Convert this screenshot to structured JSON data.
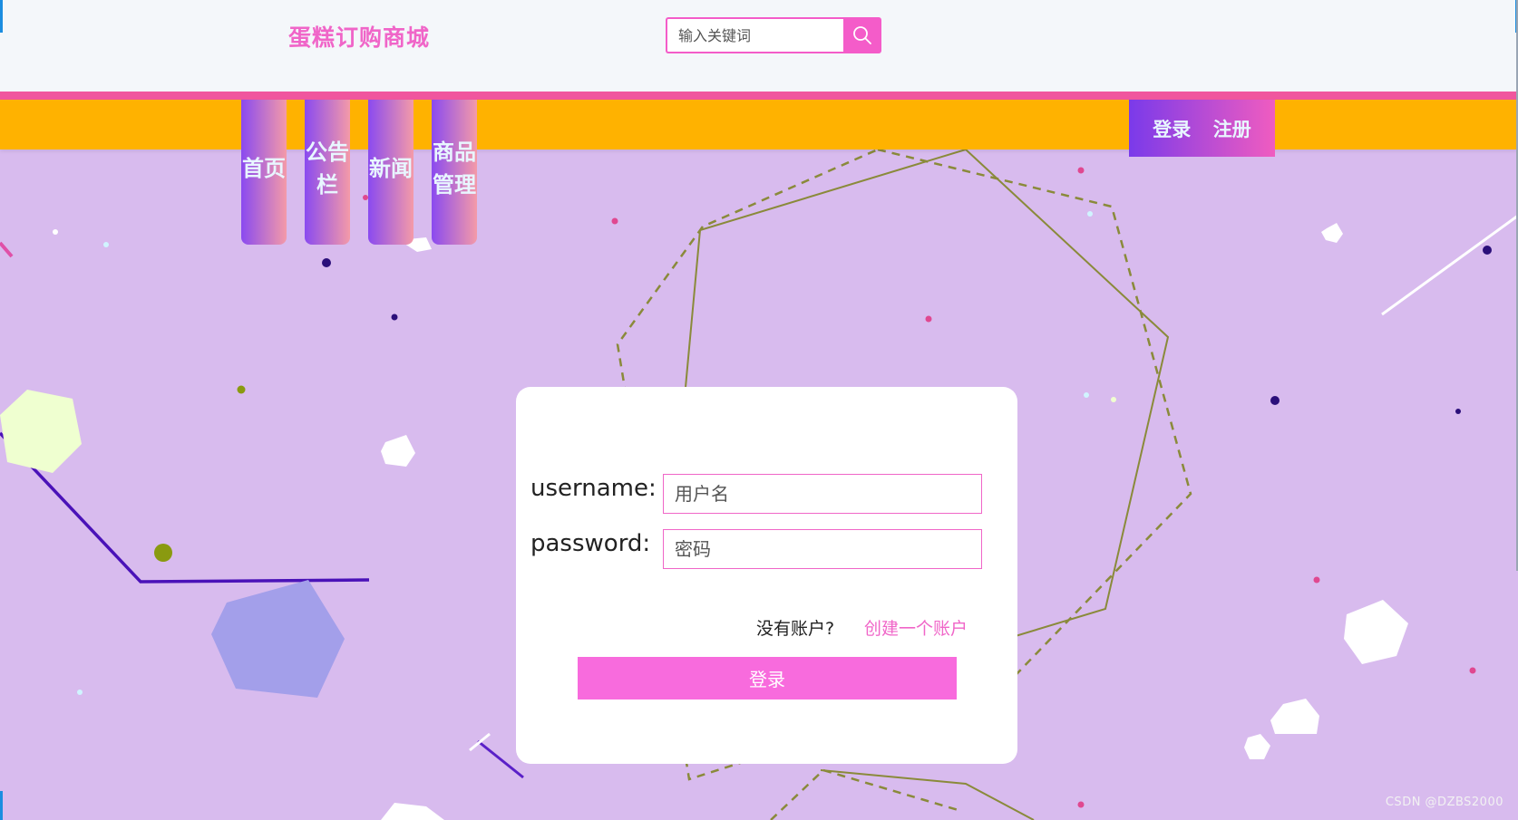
{
  "header": {
    "brand": "蛋糕订购商城",
    "search_placeholder": "输入关键词",
    "search_icon": "search-icon"
  },
  "nav": {
    "items": [
      {
        "label": "首页"
      },
      {
        "label": "公告栏"
      },
      {
        "label": "新闻"
      },
      {
        "label": "商品管理"
      }
    ],
    "login": "登录",
    "register": "注册"
  },
  "login_form": {
    "username_label": "username:",
    "username_placeholder": "用户名",
    "password_label": "password:",
    "password_placeholder": "密码",
    "no_account": "没有账户?",
    "create_account": "创建一个账户",
    "submit": "登录"
  },
  "watermark": "CSDN @DZBS2000",
  "colors": {
    "background": "#d8bbee",
    "accent_pink": "#f45cc9",
    "nav_orange": "#ffb200",
    "stripe_pink": "#f0569e"
  }
}
